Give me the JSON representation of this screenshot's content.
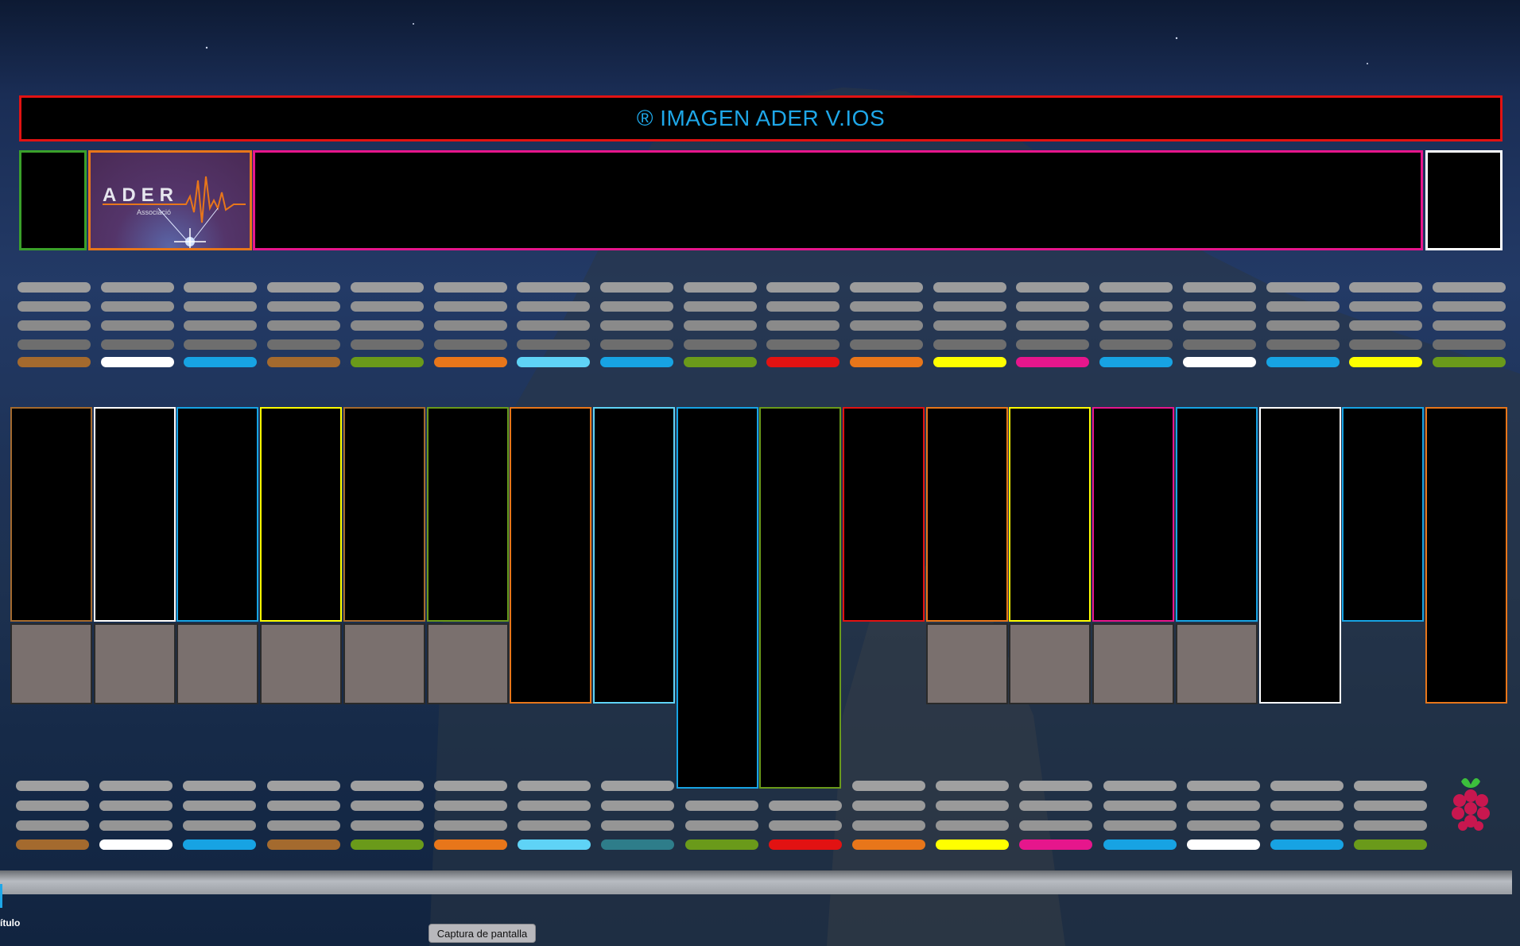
{
  "header": {
    "title": "® IMAGEN ADER V.IOS"
  },
  "logo": {
    "brand": "ADER",
    "subtitle": "Associació"
  },
  "colors": {
    "brown": "#a46a2e",
    "white": "#ffffff",
    "blue": "#17a3e3",
    "green": "#6a9a1a",
    "orange": "#e8761a",
    "cyan": "#5fd3f6",
    "red": "#e21212",
    "yellow": "#ffff00",
    "magenta": "#e6168c",
    "teal": "#2e7d8a",
    "grey": "#7a706e"
  },
  "top_strip_colors": [
    "brown",
    "white",
    "blue",
    "brown",
    "green",
    "orange",
    "cyan",
    "blue",
    "green",
    "red",
    "orange",
    "yellow",
    "magenta",
    "blue",
    "white",
    "blue",
    "yellow",
    "green"
  ],
  "bottom_strip_colors": [
    "brown",
    "white",
    "blue",
    "brown",
    "green",
    "orange",
    "cyan",
    "teal",
    "green",
    "red",
    "orange",
    "yellow",
    "magenta",
    "blue",
    "white",
    "blue",
    "green"
  ],
  "key_colors": [
    "brown",
    "white",
    "blue",
    "yellow",
    "brown",
    "green",
    "orange",
    "cyan",
    "blue",
    "green",
    "red",
    "orange",
    "yellow",
    "magenta",
    "blue",
    "white",
    "blue",
    "orange"
  ],
  "raspberry_icon": "raspberry-pi-icon",
  "dock": {
    "label": "ítulo"
  },
  "tooltip": {
    "text": "Captura de pantalla"
  }
}
